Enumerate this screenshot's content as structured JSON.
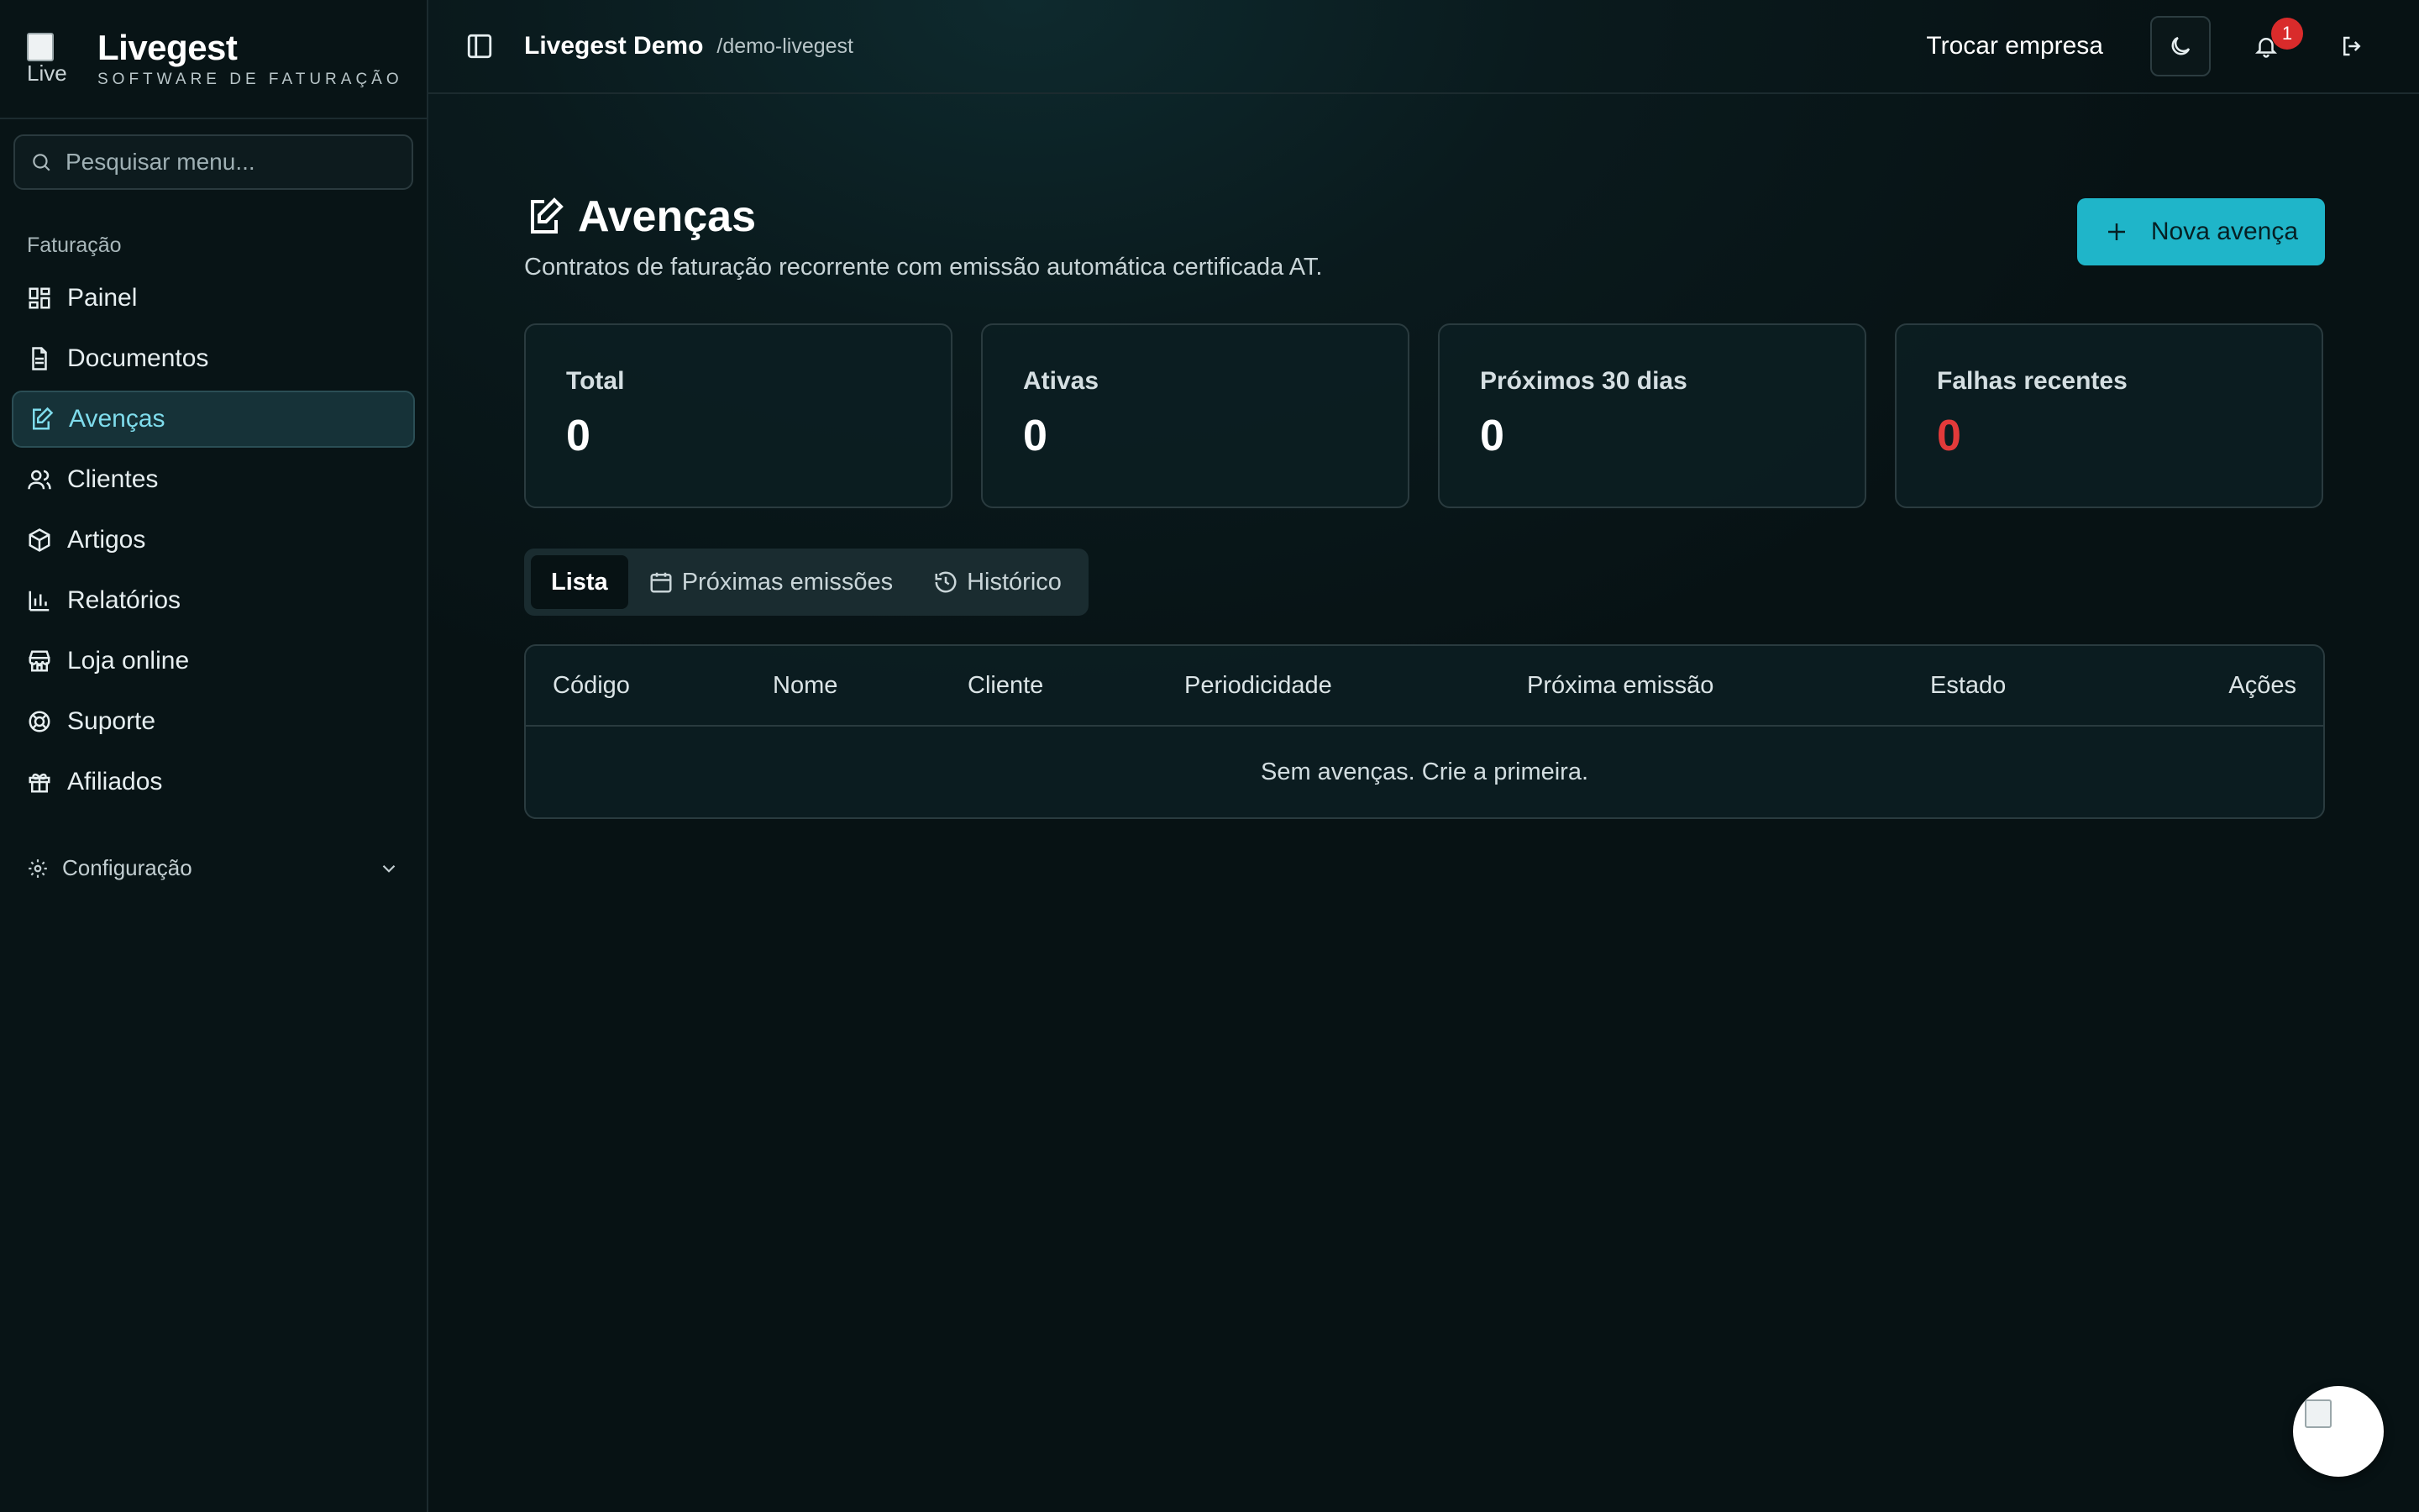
{
  "brand": {
    "logo_alt": "Live",
    "name": "Livegest",
    "tagline": "SOFTWARE DE FATURAÇÃO"
  },
  "search": {
    "placeholder": "Pesquisar menu..."
  },
  "sidebar": {
    "section": "Faturação",
    "items": [
      {
        "label": "Painel",
        "icon": "dashboard-icon"
      },
      {
        "label": "Documentos",
        "icon": "document-icon"
      },
      {
        "label": "Avenças",
        "icon": "edit-document-icon"
      },
      {
        "label": "Clientes",
        "icon": "users-icon"
      },
      {
        "label": "Artigos",
        "icon": "package-icon"
      },
      {
        "label": "Relatórios",
        "icon": "bar-chart-icon"
      },
      {
        "label": "Loja online",
        "icon": "store-icon"
      },
      {
        "label": "Suporte",
        "icon": "lifebuoy-icon"
      },
      {
        "label": "Afiliados",
        "icon": "gift-icon"
      }
    ],
    "active_item": "Avenças",
    "config_label": "Configuração"
  },
  "topbar": {
    "company": "Livegest Demo",
    "slug": "/demo-livegest",
    "switch_company": "Trocar empresa",
    "notifications_count": "1"
  },
  "page": {
    "title": "Avenças",
    "subtitle": "Contratos de faturação recorrente com emissão automática certificada AT.",
    "new_button": "Nova avença"
  },
  "stats": [
    {
      "label": "Total",
      "value": "0"
    },
    {
      "label": "Ativas",
      "value": "0"
    },
    {
      "label": "Próximos 30 dias",
      "value": "0"
    },
    {
      "label": "Falhas recentes",
      "value": "0",
      "color": "#e23a3a"
    }
  ],
  "tabs": [
    {
      "label": "Lista",
      "active": true
    },
    {
      "label": "Próximas emissões",
      "icon": "calendar-icon"
    },
    {
      "label": "Histórico",
      "icon": "history-icon"
    }
  ],
  "table": {
    "columns": [
      "Código",
      "Nome",
      "Cliente",
      "Periodicidade",
      "Próxima emissão",
      "Estado",
      "Ações"
    ],
    "empty_text": "Sem avenças. Crie a primeira."
  },
  "colors": {
    "accent": "#1fb5c9",
    "active_nav": "#7fdcec",
    "danger": "#e23a3a"
  }
}
